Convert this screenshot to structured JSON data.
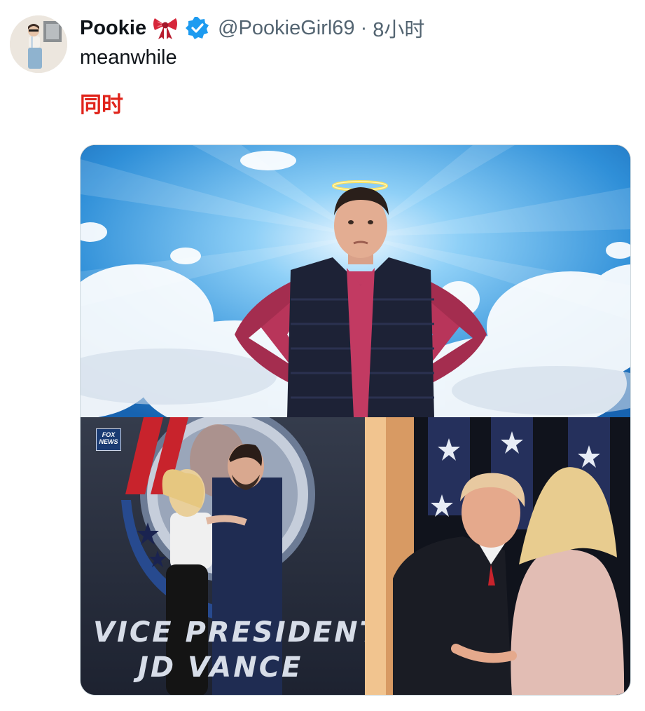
{
  "post": {
    "author_name": "Pookie",
    "author_handle": "@PookieGirl69",
    "separator": "·",
    "timestamp": "8小时",
    "text": "meanwhile",
    "translation": "同时"
  },
  "media": {
    "bottom_left_screen_line1": "VICE PRESIDENT",
    "bottom_left_screen_line2": "JD VANCE",
    "bottom_left_logo": "FOX NEWS"
  },
  "icons": {
    "bow": "ribbon-bow-emoji",
    "verified": "verified-badge"
  },
  "colors": {
    "name": "#0f1419",
    "meta": "#536471",
    "verified": "#1d9bf0",
    "translation": "#e0241b",
    "bow": "#d6263a"
  }
}
